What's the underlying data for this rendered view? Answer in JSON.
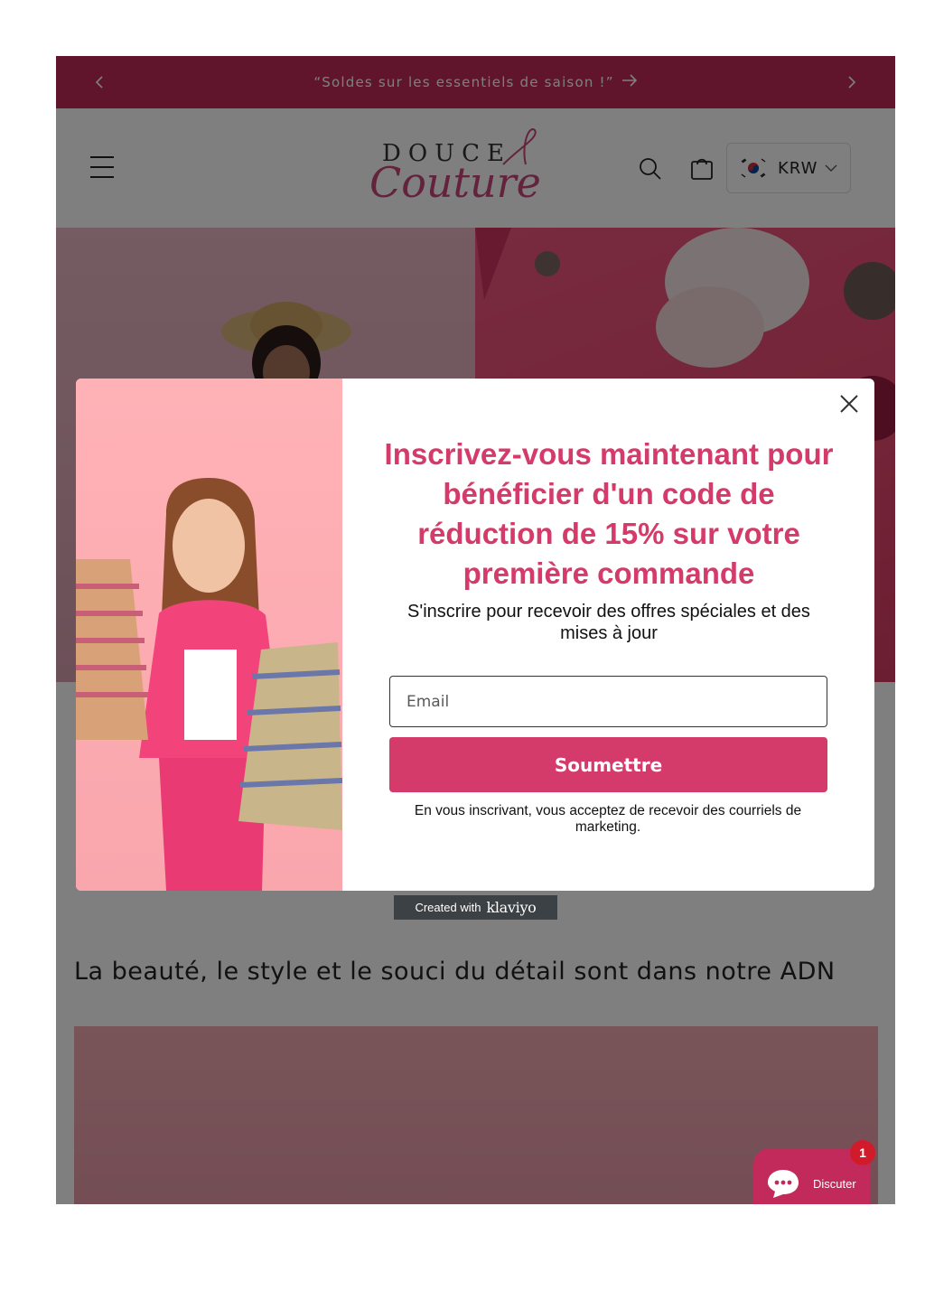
{
  "announcement": {
    "text": "“Soldes sur les essentiels de saison !”",
    "prev_icon": "chevron-left-icon",
    "next_icon": "chevron-right-icon",
    "arrow_icon": "arrow-right-icon"
  },
  "header": {
    "logo_text_top": "DOUCE",
    "logo_text_script": "Couture",
    "currency": {
      "flag": "south-korea-flag-icon",
      "code": "KRW"
    },
    "icons": [
      "menu-icon",
      "search-icon",
      "cart-icon",
      "chevron-down-icon"
    ]
  },
  "main": {
    "tagline": "La beauté, le style et le souci du détail sont dans notre ADN"
  },
  "popup": {
    "headline": "Inscrivez-vous maintenant pour bénéficier d'un code de réduction de 15% sur votre première commande",
    "subtext": "S'inscrire pour recevoir des offres spéciales et des mises à jour",
    "email_placeholder": "Email",
    "submit_label": "Soumettre",
    "legal": "En vous inscrivant, vous acceptez de recevoir des courriels de marketing.",
    "close_icon": "close-icon"
  },
  "klaviyo": {
    "prefix": "Created with",
    "brand": "klaviyo"
  },
  "chat": {
    "label": "Discuter",
    "badge": "1"
  },
  "colors": {
    "brand": "#c12a5a",
    "accent": "#d43a6a",
    "badge": "#d11b2b"
  }
}
